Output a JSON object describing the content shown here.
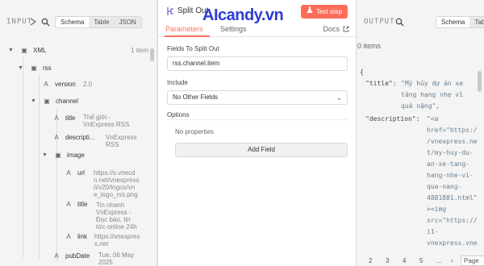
{
  "watermark": "AIcandy.vn",
  "input_panel": {
    "title": "INPUT",
    "views": [
      "Schema",
      "Table",
      "JSON"
    ],
    "active_view": "Schema",
    "tree": {
      "root": {
        "key": "XML",
        "count": "1 item"
      },
      "rss": {
        "key": "rss"
      },
      "version": {
        "key": "version",
        "value": "2.0"
      },
      "channel": {
        "key": "channel"
      },
      "title": {
        "key": "title",
        "value_lines": [
          "Thế giới -",
          "VnExpress RSS"
        ]
      },
      "description": {
        "key": "descripti...",
        "value_lines": [
          "VnExpress",
          "RSS"
        ]
      },
      "image": {
        "key": "image"
      },
      "url": {
        "key": "url",
        "value_lines": [
          "https://s.vnecd",
          "n.net/vnexpress",
          "/i/v20/logos/vn",
          "e_logo_rss.png"
        ]
      },
      "image_title": {
        "key": "title",
        "value_lines": [
          "Tin nhanh",
          "VnExpress -",
          "Đọc báo, tin",
          "tức online 24h"
        ]
      },
      "link": {
        "key": "link",
        "value_lines": [
          "https://vnexpres",
          "s.net"
        ]
      },
      "pubDate": {
        "key": "pubDate",
        "value_lines": [
          "Tue, 06 May",
          "2025"
        ]
      }
    }
  },
  "node": {
    "title": "Split Out",
    "test_button": "Test step",
    "tabs": [
      "Parameters",
      "Settings"
    ],
    "docs": "Docs",
    "fields_to_split_label": "Fields To Split Out",
    "fields_to_split_value": "rss.channel.item",
    "include_label": "Include",
    "include_value": "No Other Fields",
    "options_label": "Options",
    "no_properties": "No properties",
    "add_field": "Add Field"
  },
  "output_panel": {
    "title": "OUTPUT",
    "views": [
      "Schema",
      "Table"
    ],
    "active_view": "Schema",
    "items": "0 items",
    "json": {
      "open_brace": "{",
      "title_key": "\"title\":",
      "title_lines": [
        "\"Mỹ hủy dự án xe",
        "tăng hạng nhẹ vì",
        "quá nặng\","
      ],
      "desc_key": "\"description\":",
      "desc_lines": [
        "\"<a",
        "href=\"https:/",
        "/vnexpress.ne",
        "t/my-huy-du-",
        "an-xe-tang-",
        "hang-nhe-vi-",
        "qua-nang-",
        "4881881.html\"",
        "><img",
        "src=\"https://",
        "i1-",
        "vnexpress.vne"
      ]
    },
    "pager": [
      "2",
      "3",
      "4",
      "5",
      "..."
    ],
    "page_size": "Page S"
  },
  "colors": {
    "accent": "#ff6d5a",
    "watermark": "#2c3cd6"
  }
}
